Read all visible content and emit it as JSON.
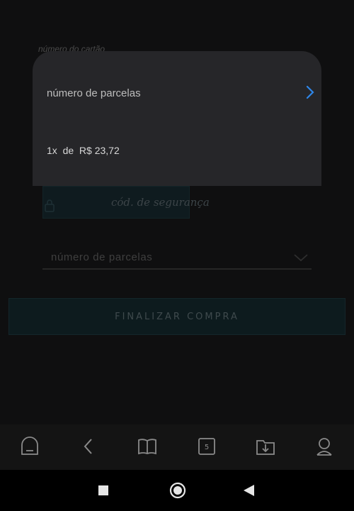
{
  "background_form": {
    "card_number_label": "número do cartão",
    "security_code_placeholder": "cód. de segurança",
    "installments_placeholder": "número de parcelas",
    "submit_label": "FINALIZAR COMPRA"
  },
  "dialog": {
    "title": "número de parcelas",
    "option": "1x  de  R$ 23,72"
  },
  "app_nav": {
    "items": [
      {
        "icon": "home-icon"
      },
      {
        "icon": "back-icon"
      },
      {
        "icon": "book-icon"
      },
      {
        "icon": "tabs-icon",
        "badge": "5"
      },
      {
        "icon": "download-icon"
      },
      {
        "icon": "profile-icon"
      }
    ]
  },
  "system_nav": {
    "items": [
      {
        "icon": "recents-square-icon"
      },
      {
        "icon": "home-circle-icon"
      },
      {
        "icon": "back-triangle-icon"
      }
    ]
  },
  "colors": {
    "accent": "#2e86e8",
    "dialog_bg": "#262629",
    "screen_bg": "#0f0f10"
  }
}
